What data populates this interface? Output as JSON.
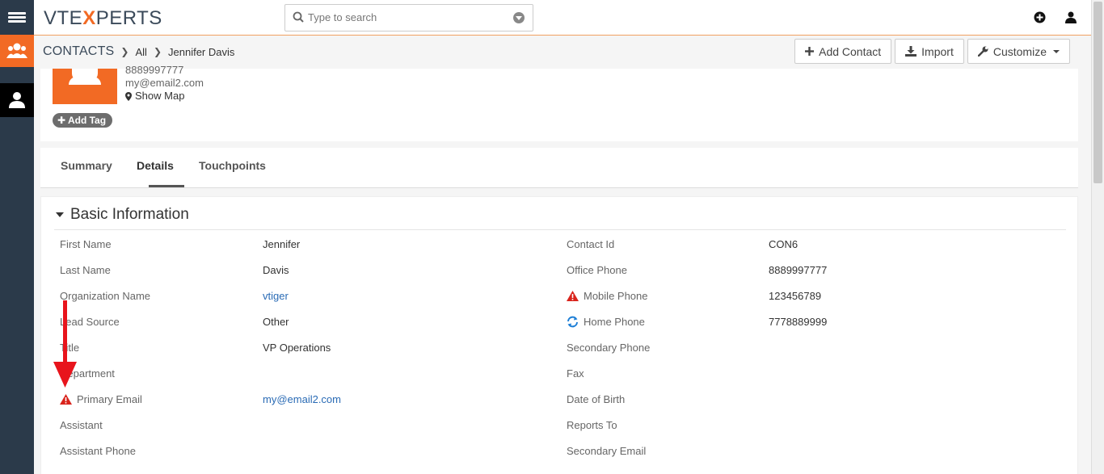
{
  "brand": {
    "logo_a": "VTE",
    "logo_x": "X",
    "logo_b": "PERTS",
    "accent": "#f26a24",
    "rail": "#2b3a4a"
  },
  "search": {
    "placeholder": "Type to search"
  },
  "topbar_icons": [
    "plus-circle-icon",
    "user-icon"
  ],
  "breadcrumb": {
    "module": "CONTACTS",
    "filter": "All",
    "record": "Jennifer Davis"
  },
  "header_buttons": [
    {
      "label": "Add Contact",
      "icon": "plus-icon"
    },
    {
      "label": "Import",
      "icon": "download-icon"
    },
    {
      "label": "Customize",
      "icon": "wrench-icon"
    }
  ],
  "record": {
    "phone": "8889997777",
    "email": "my@email2.com",
    "map": "Show Map",
    "add_tag": "Add Tag"
  },
  "tabs": [
    "Summary",
    "Details",
    "Touchpoints"
  ],
  "active_tab": "Details",
  "section": {
    "title": "Basic Information"
  },
  "fields": [
    {
      "l1": "First Name",
      "v1": "Jennifer",
      "l2": "Contact Id",
      "v2": "CON6"
    },
    {
      "l1": "Last Name",
      "v1": "Davis",
      "l2": "Office Phone",
      "v2": "8889997777"
    },
    {
      "l1": "Organization Name",
      "v1": "vtiger",
      "l2": "Mobile Phone",
      "v2": "123456789"
    },
    {
      "l1": "Lead Source",
      "v1": "Other",
      "l2": "Home Phone",
      "v2": "7778889999"
    },
    {
      "l1": "Title",
      "v1": "VP Operations",
      "l2": "Secondary Phone",
      "v2": ""
    },
    {
      "l1": "Department",
      "v1": "",
      "l2": "Fax",
      "v2": ""
    },
    {
      "l1": "Primary Email",
      "v1": "my@email2.com",
      "l2": "Date of Birth",
      "v2": ""
    },
    {
      "l1": "Assistant",
      "v1": "",
      "l2": "Reports To",
      "v2": ""
    },
    {
      "l1": "Assistant Phone",
      "v1": "",
      "l2": "Secondary Email",
      "v2": ""
    }
  ]
}
